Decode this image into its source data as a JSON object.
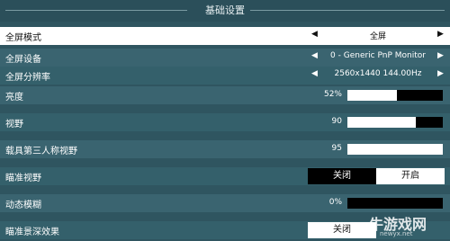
{
  "section_title": "基础设置",
  "rows": {
    "fullscreen_mode": {
      "label": "全屏模式",
      "value": "全屏"
    },
    "fullscreen_monitor": {
      "label": "全屏设备",
      "value": "0 - Generic PnP Monitor"
    },
    "fullscreen_resolution": {
      "label": "全屏分辨率",
      "value": "2560x1440 144.00Hz"
    },
    "brightness": {
      "label": "亮度",
      "value_text": "52%",
      "level": 0.52
    },
    "fov": {
      "label": "视野",
      "value_text": "90",
      "level": 0.72
    },
    "vehicle_fov": {
      "label": "载具第三人称视野",
      "value_text": "95",
      "level": 1.0
    },
    "aim_fov": {
      "label": "瞄准视野",
      "off": "关闭",
      "on": "开启",
      "selected": "on"
    },
    "motion_blur": {
      "label": "动态模糊",
      "value_text": "0%",
      "level": 0.0
    },
    "aim_dof": {
      "label": "瞄准景深效果",
      "off": "关闭"
    }
  },
  "watermark": {
    "text": "牛游戏网",
    "sub": "newyx.net"
  },
  "icons": {
    "left_arrow": "triangle-left",
    "right_arrow": "triangle-right"
  }
}
